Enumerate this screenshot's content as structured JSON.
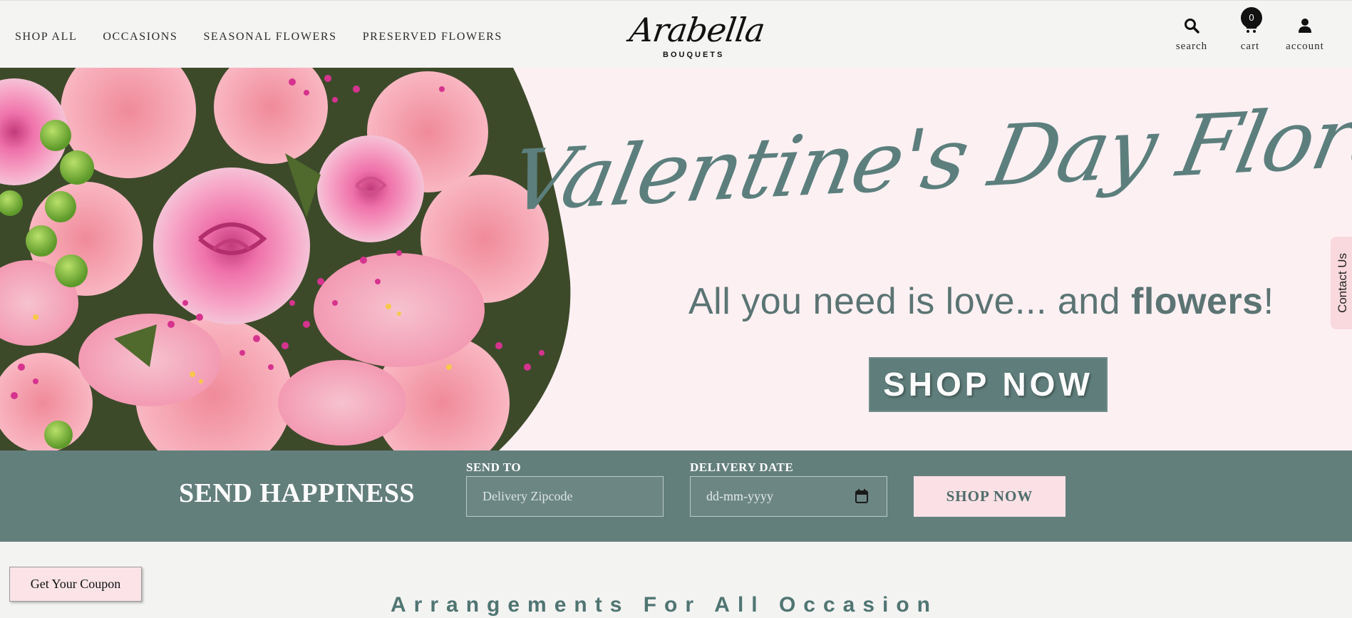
{
  "nav": {
    "items": [
      {
        "label": "SHOP ALL"
      },
      {
        "label": "OCCASIONS"
      },
      {
        "label": "SEASONAL FLOWERS"
      },
      {
        "label": "PRESERVED FLOWERS"
      }
    ]
  },
  "logo": {
    "script": "Arabella",
    "sub": "BOUQUETS"
  },
  "header_icons": {
    "search_label": "search",
    "cart_label": "cart",
    "cart_count": "0",
    "account_label": "account"
  },
  "hero": {
    "title": "Valentine's Day Florals",
    "subtitle_prefix": "All you need is love... and ",
    "subtitle_bold": "flowers",
    "subtitle_suffix": "!",
    "button": "SHOP NOW"
  },
  "contact_tab": "Contact Us",
  "send_bar": {
    "heading": "SEND HAPPINESS",
    "send_to_label": "SEND TO",
    "zip_placeholder": "Delivery Zipcode",
    "date_label": "DELIVERY DATE",
    "date_placeholder": "dd-mm-yyyy",
    "button": "SHOP NOW"
  },
  "coupon_button": "Get Your Coupon",
  "section_title": "Arrangements For All Occasion",
  "colors": {
    "teal": "#637f7c",
    "pink_light": "#fbe0e6",
    "hero_bg": "#fdf0f3",
    "title_teal": "#5c7f7d"
  },
  "icons": [
    "search-icon",
    "cart-icon",
    "account-icon",
    "calendar-icon"
  ]
}
